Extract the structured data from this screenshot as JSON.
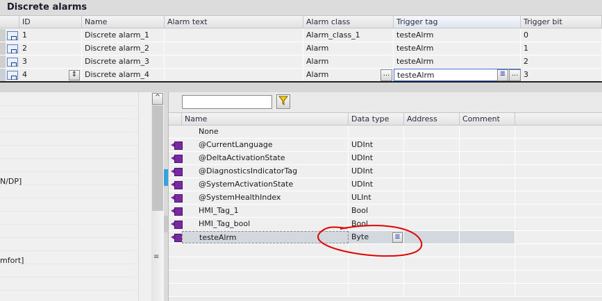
{
  "title": "Discrete alarms",
  "alarm_table": {
    "columns": [
      "ID",
      "Name",
      "Alarm text",
      "Alarm class",
      "Trigger tag",
      "Trigger bit"
    ],
    "rows": [
      {
        "id": "1",
        "name": "Discrete alarm_1",
        "text": "",
        "class": "Alarm_class_1",
        "tag": "testeAlrm",
        "bit": "0"
      },
      {
        "id": "2",
        "name": "Discrete alarm_2",
        "text": "",
        "class": "Alarm",
        "tag": "testeAlrm",
        "bit": "1"
      },
      {
        "id": "3",
        "name": "Discrete alarm_3",
        "text": "",
        "class": "Alarm",
        "tag": "testeAlrm",
        "bit": "2"
      },
      {
        "id": "4",
        "name": "Discrete alarm_4",
        "text": "",
        "class": "Alarm",
        "tag": "testeAlrm",
        "bit": "3"
      }
    ],
    "ellipsis": "..."
  },
  "left_panel": {
    "fragments": [
      "N/DP]",
      "mfort]"
    ]
  },
  "tag_picker": {
    "filter_value": "",
    "columns": [
      "Name",
      "Data type",
      "Address",
      "Comment"
    ],
    "rows": [
      {
        "name": "None",
        "type": ""
      },
      {
        "name": "@CurrentLanguage",
        "type": "UDInt"
      },
      {
        "name": "@DeltaActivationState",
        "type": "UDInt"
      },
      {
        "name": "@DiagnosticsIndicatorTag",
        "type": "UDInt"
      },
      {
        "name": "@SystemActivationState",
        "type": "UDInt"
      },
      {
        "name": "@SystemHealthIndex",
        "type": "ULInt"
      },
      {
        "name": "HMI_Tag_1",
        "type": "Bool"
      },
      {
        "name": "HMI_Tag_bool",
        "type": "Bool"
      },
      {
        "name": "testeAlrm",
        "type": "Byte"
      }
    ]
  },
  "colors": {
    "annotation": "#e00000",
    "selected_row": "#d2d8de",
    "edit_border": "#3a6ad0"
  }
}
